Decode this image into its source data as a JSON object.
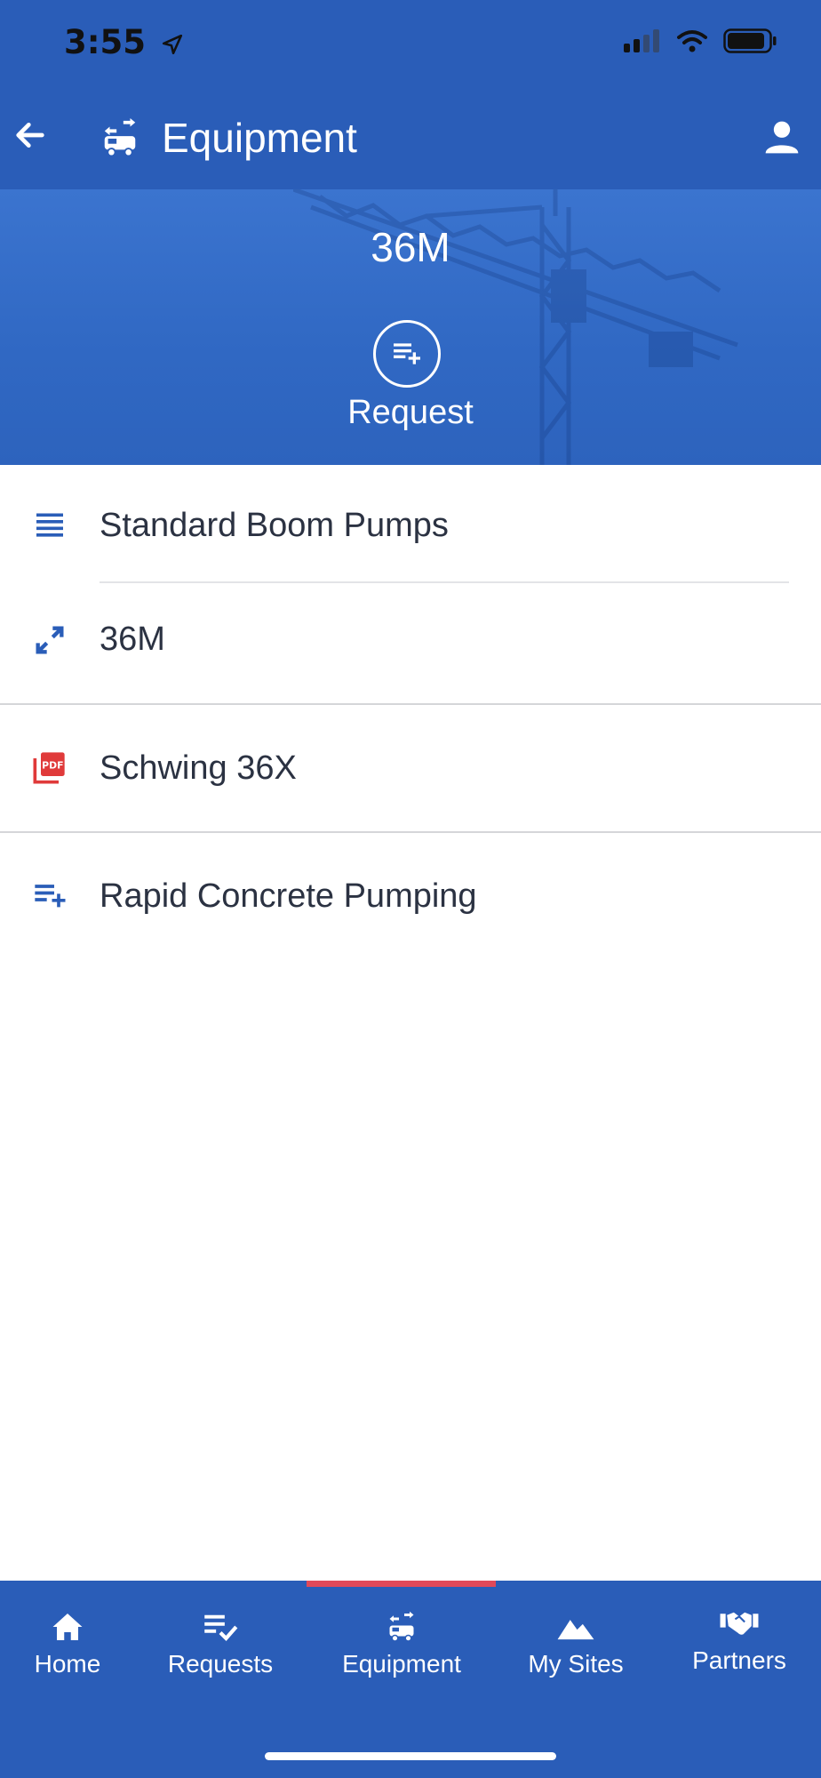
{
  "status_bar": {
    "time": "3:55"
  },
  "nav": {
    "title": "Equipment"
  },
  "hero": {
    "title": "36M",
    "request_label": "Request"
  },
  "list": {
    "items": [
      {
        "icon": "list-icon",
        "label": "Standard Boom Pumps"
      },
      {
        "icon": "expand-icon",
        "label": "36M"
      },
      {
        "icon": "pdf-icon",
        "label": "Schwing 36X"
      },
      {
        "icon": "playlist-add-icon",
        "label": "Rapid Concrete Pumping"
      }
    ]
  },
  "tabs": [
    {
      "icon": "home-icon",
      "label": "Home"
    },
    {
      "icon": "requests-icon",
      "label": "Requests"
    },
    {
      "icon": "equipment-icon",
      "label": "Equipment",
      "active": true
    },
    {
      "icon": "mountain-icon",
      "label": "My Sites"
    },
    {
      "icon": "handshake-icon",
      "label": "Partners"
    }
  ],
  "colors": {
    "primary": "#2a5db8",
    "hero": "#3068c3",
    "active_tab_indicator": "#e0495a",
    "icon_blue": "#2a5db8",
    "pdf_red": "#e03a3a",
    "text": "#2b3242"
  }
}
